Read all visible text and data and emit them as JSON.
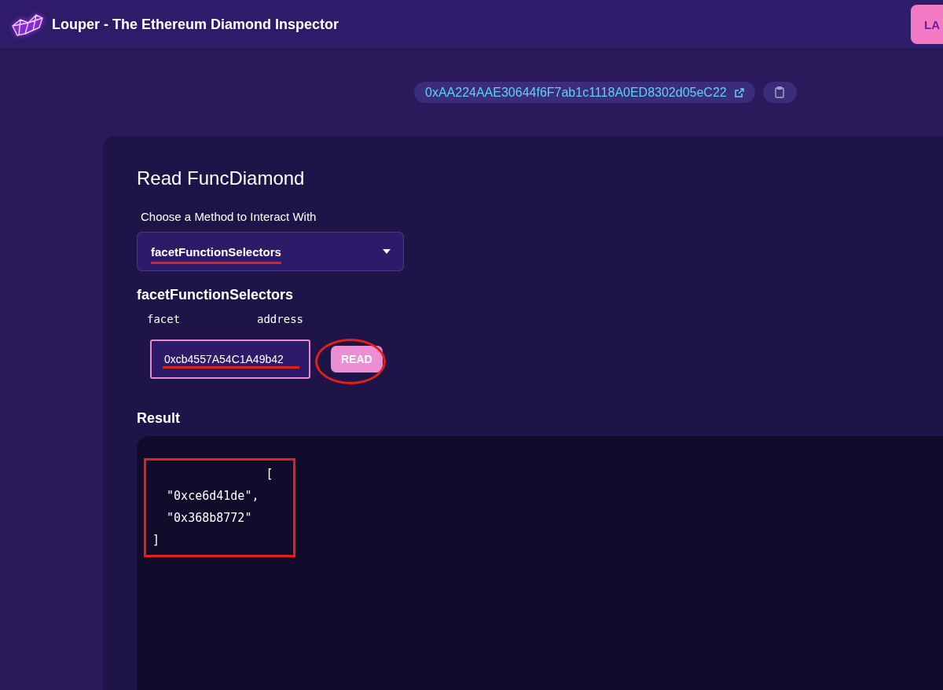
{
  "header": {
    "title": "Louper - The Ethereum Diamond Inspector",
    "button": "LA"
  },
  "address": {
    "value": "0xAA224AAE30644f6F7ab1c1118A0ED8302d05eC22"
  },
  "card": {
    "title": "Read FuncDiamond",
    "method_label": "Choose a Method to Interact With",
    "method_select": {
      "value": "facetFunctionSelectors",
      "underlined": true
    },
    "function_name": "facetFunctionSelectors",
    "params": [
      {
        "name": "facet",
        "type": "address",
        "value": "0xcb4557A54C1A49b42",
        "underlined": true
      }
    ],
    "read_button": {
      "label": "READ",
      "circled": true
    },
    "result_label": "Result",
    "result": {
      "text": "                [\n  \"0xce6d41de\",\n  \"0x368b8772\"\n]",
      "boxed": true
    }
  }
}
